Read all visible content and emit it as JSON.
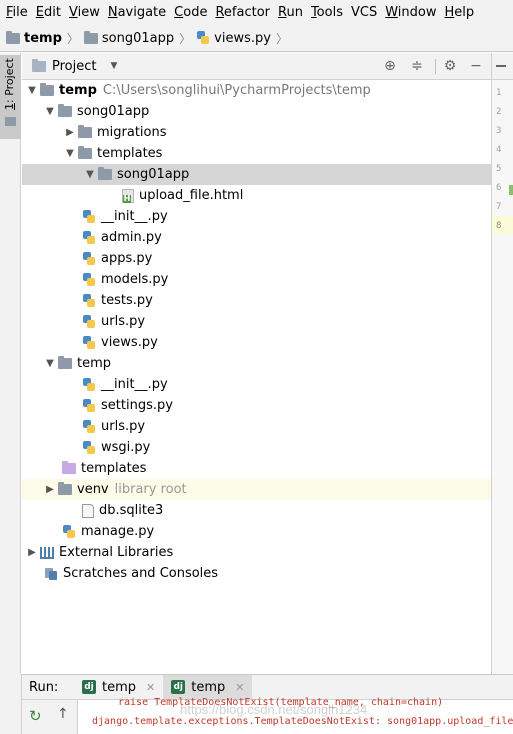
{
  "menu": {
    "items": [
      {
        "label": "File",
        "u": "F",
        "rest": "ile"
      },
      {
        "label": "Edit",
        "u": "E",
        "rest": "dit"
      },
      {
        "label": "View",
        "u": "V",
        "rest": "iew"
      },
      {
        "label": "Navigate",
        "u": "N",
        "rest": "avigate"
      },
      {
        "label": "Code",
        "u": "C",
        "rest": "ode"
      },
      {
        "label": "Refactor",
        "u": "R",
        "rest": "efactor"
      },
      {
        "label": "Run",
        "u": "R",
        "rest": "un"
      },
      {
        "label": "Tools",
        "u": "T",
        "rest": "ools"
      },
      {
        "label": "VCS",
        "u": "",
        "rest": "VCS"
      },
      {
        "label": "Window",
        "u": "W",
        "rest": "indow"
      },
      {
        "label": "Help",
        "u": "H",
        "rest": "elp"
      }
    ]
  },
  "breadcrumb": {
    "project": "temp",
    "folder": "song01app",
    "file": "views.py"
  },
  "side_tab": {
    "prefix": "1",
    "label": ": Project"
  },
  "panel": {
    "title": "Project",
    "dropdown_icon": "chevron-down-icon"
  },
  "tree": {
    "root": {
      "label": "temp",
      "path": "C:\\Users\\songlihui\\PycharmProjects\\temp"
    },
    "song01app": "song01app",
    "migrations": "migrations",
    "templates": "templates",
    "song01app_templates": "song01app",
    "upload_file": "upload_file.html",
    "app_files": [
      "__init__.py",
      "admin.py",
      "apps.py",
      "models.py",
      "tests.py",
      "urls.py",
      "views.py"
    ],
    "temp_pkg": "temp",
    "temp_files": [
      "__init__.py",
      "settings.py",
      "urls.py",
      "wsgi.py"
    ],
    "templates_root": "templates",
    "venv": {
      "label": "venv",
      "hint": "library root"
    },
    "db": "db.sqlite3",
    "manage": "manage.py",
    "external_libraries": "External Libraries",
    "scratches": "Scratches and Consoles"
  },
  "gutter": {
    "line_numbers": [
      "1",
      "2",
      "3",
      "4",
      "5",
      "6",
      "7",
      "8"
    ],
    "current_line": "8"
  },
  "run": {
    "label": "Run:",
    "tabs": [
      {
        "label": "temp",
        "active": false
      },
      {
        "label": "temp",
        "active": true
      }
    ],
    "console_lines": [
      "raise TemplateDoesNotExist(template_name, chain=chain)",
      "django.template.exceptions.TemplateDoesNotExist: song01app.upload_file"
    ],
    "watermark": "https://blog.csdn.net/songlh1234"
  },
  "colors": {
    "selection": "#d5d5d5",
    "venv_highlight": "#fbfbe8",
    "error_text": "#c0392b",
    "django_icon": "#2b6f4a"
  }
}
